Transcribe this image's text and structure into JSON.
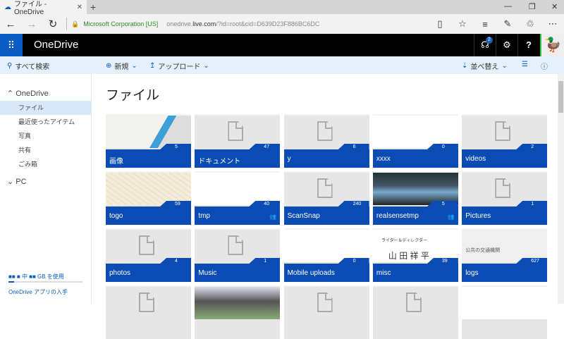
{
  "browser": {
    "tab_title": "ファイル - OneDrive",
    "cert": "Microsoft Corporation [US]",
    "url_pre": "onedrive.",
    "url_host": "live.com",
    "url_post": "/?id=root&cid=D639D23F886BC6DC"
  },
  "header": {
    "app_name": "OneDrive",
    "notifications": "2"
  },
  "commands": {
    "search": "すべて検索",
    "new": "新規",
    "upload": "アップロード",
    "sort": "並べ替え"
  },
  "sidebar": {
    "onedrive": "OneDrive",
    "items": [
      "ファイル",
      "最近使ったアイテム",
      "写真",
      "共有",
      "ごみ箱"
    ],
    "pc": "PC",
    "quota": "■■ ■ 中 ■■ GB を使用",
    "get_app": "OneDrive アプリの入手"
  },
  "page": {
    "title": "ファイル"
  },
  "tiles": [
    {
      "name": "画像",
      "count": "5",
      "thumb": "image"
    },
    {
      "name": "ドキュメント",
      "count": "47",
      "thumb": "files"
    },
    {
      "name": "y",
      "count": "6",
      "thumb": "file"
    },
    {
      "name": "xxxx",
      "count": "0",
      "thumb": "blank"
    },
    {
      "name": "videos",
      "count": "2",
      "thumb": "file"
    },
    {
      "name": "togo",
      "count": "59",
      "thumb": "map"
    },
    {
      "name": "tmp",
      "count": "40",
      "thumb": "doc",
      "shared": true
    },
    {
      "name": "ScanSnap",
      "count": "240",
      "thumb": "file"
    },
    {
      "name": "realsensetmp",
      "count": "5",
      "thumb": "stage",
      "shared": true
    },
    {
      "name": "Pictures",
      "count": "1",
      "thumb": "file"
    },
    {
      "name": "photos",
      "count": "4",
      "thumb": "file"
    },
    {
      "name": "Music",
      "count": "1",
      "thumb": "file"
    },
    {
      "name": "Mobile uploads",
      "count": "0",
      "thumb": "blank"
    },
    {
      "name": "misc",
      "count": "39",
      "thumb": "card",
      "line1": "ライター＆ディレクター",
      "line2": "山 田 祥 平"
    },
    {
      "name": "logs",
      "count": "627",
      "thumb": "settings",
      "line1": "公共の交通機関"
    },
    {
      "name": "",
      "count": "",
      "thumb": "file"
    },
    {
      "name": "",
      "count": "",
      "thumb": "house"
    },
    {
      "name": "",
      "count": "",
      "thumb": "file"
    },
    {
      "name": "",
      "count": "",
      "thumb": "file"
    },
    {
      "name": "",
      "count": "",
      "thumb": "blank"
    }
  ]
}
